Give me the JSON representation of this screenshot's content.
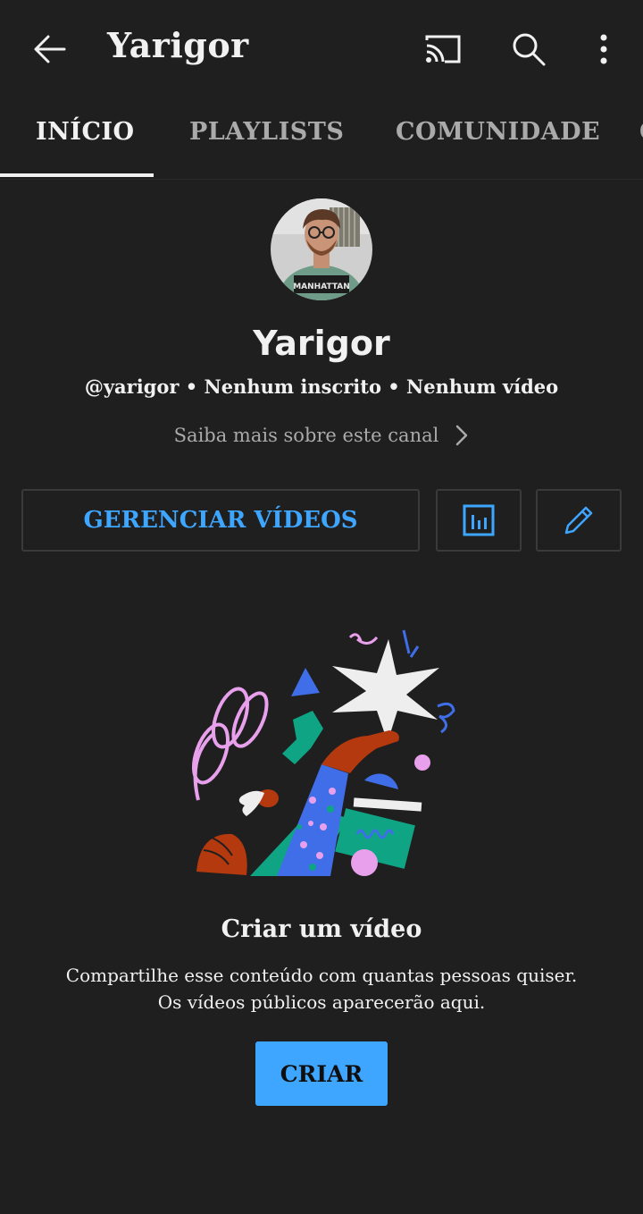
{
  "header": {
    "title": "Yarigor",
    "icons": {
      "back": "arrow-left-icon",
      "cast": "cast-icon",
      "search": "search-icon",
      "more": "more-vert-icon"
    }
  },
  "tabs": [
    {
      "label": "INÍCIO",
      "active": true
    },
    {
      "label": "PLAYLISTS",
      "active": false
    },
    {
      "label": "COMUNIDADE",
      "active": false
    },
    {
      "label": "C",
      "active": false
    }
  ],
  "channel": {
    "name": "Yarigor",
    "meta": "@yarigor • Nenhum inscrito • Nenhum vídeo",
    "about_link": "Saiba mais sobre este canal",
    "avatar_shirt_text": "MANHATTAN"
  },
  "actions": {
    "manage_label": "GERENCIAR VÍDEOS",
    "stats_icon": "bar-chart-icon",
    "edit_icon": "pencil-icon"
  },
  "empty_state": {
    "title": "Criar um vídeo",
    "description_line1": "Compartilhe esse conteúdo com quantas pessoas quiser.",
    "description_line2": "Os vídeos públicos aparecerão aqui.",
    "create_label": "CRIAR"
  },
  "colors": {
    "background": "#1f1f1f",
    "accent": "#3ea6ff",
    "text_primary": "#f1f1f1",
    "text_secondary": "#aaaaaa",
    "border": "#3a3a3a"
  }
}
